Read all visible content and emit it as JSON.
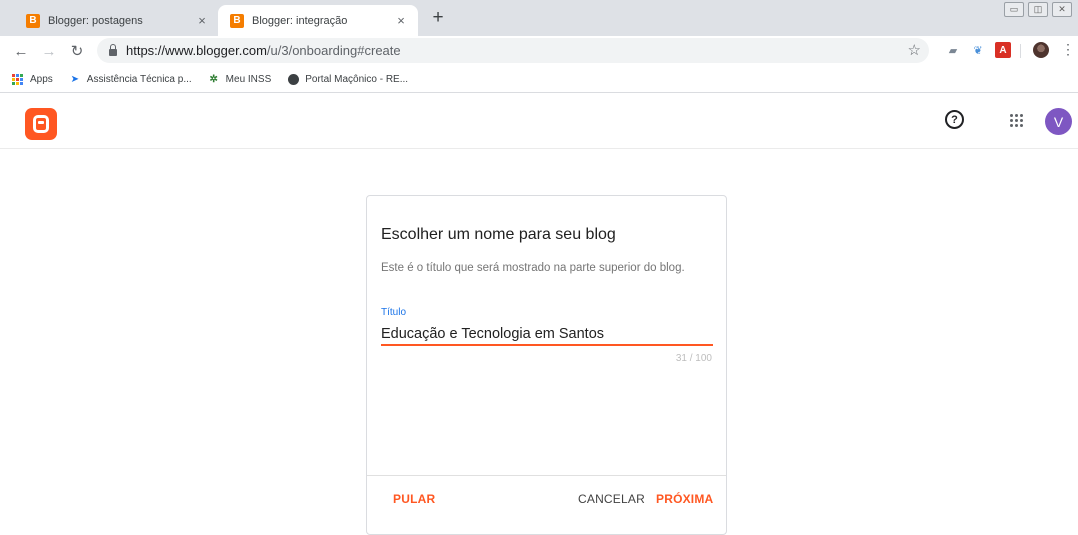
{
  "browser": {
    "tabs": [
      {
        "title": "Blogger: postagens",
        "favicon": "B",
        "active": false
      },
      {
        "title": "Blogger: integração",
        "favicon": "B",
        "active": true
      }
    ],
    "new_tab_label": "+",
    "close_glyph": "×",
    "url_host": "https://www.blogger.com",
    "url_path": "/u/3/onboarding#create",
    "bookmarks": [
      {
        "label": "Apps",
        "icon": "apps-grid-icon"
      },
      {
        "label": "Assistência Técnica p...",
        "icon": "arrow-icon"
      },
      {
        "label": "Meu INSS",
        "icon": "inss-icon"
      },
      {
        "label": "Portal Maçônico - RE...",
        "icon": "globe-icon"
      }
    ]
  },
  "header": {
    "avatar_letter": "V",
    "help_glyph": "?"
  },
  "dialog": {
    "title": "Escolher um nome para seu blog",
    "subtitle": "Este é o título que será mostrado na parte superior do blog.",
    "field_label": "Título",
    "field_value": "Educação e Tecnologia em Santos",
    "counter": "31 / 100",
    "skip_label": "PULAR",
    "cancel_label": "CANCELAR",
    "next_label": "PRÓXIMA"
  },
  "colors": {
    "accent": "#ff5722",
    "link_blue": "#1a73e8",
    "avatar": "#7e57c2"
  }
}
